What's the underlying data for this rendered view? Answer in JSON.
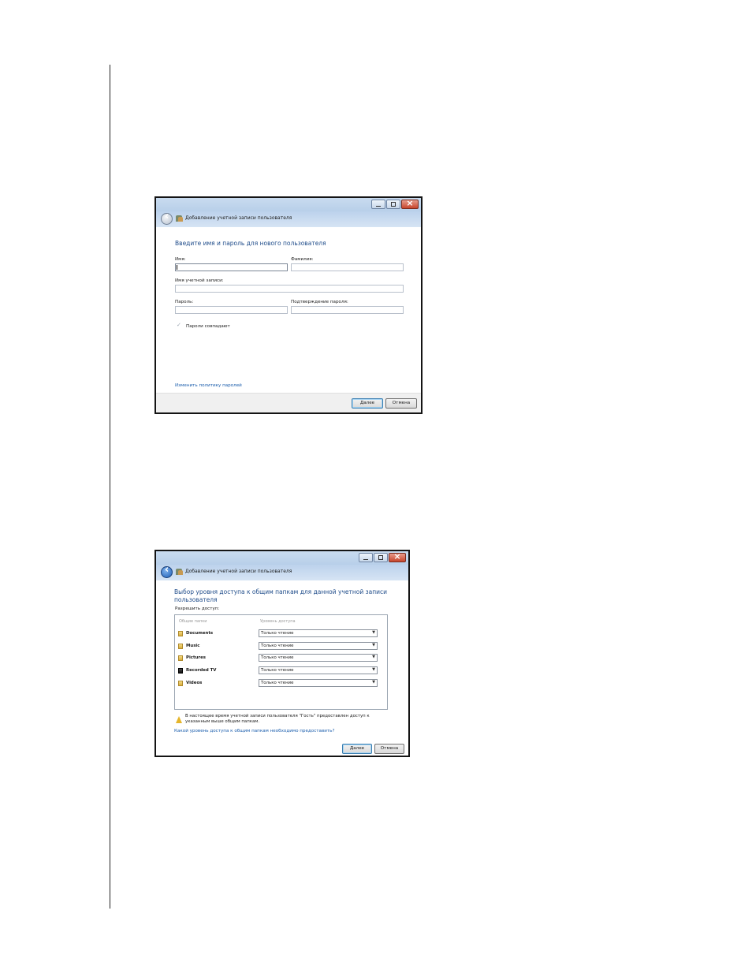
{
  "dialog_add_user": {
    "title": "Добавление учетной записи пользователя",
    "heading": "Введите имя и пароль для нового пользователя",
    "first_name_label": "Имя:",
    "last_name_label": "Фамилия:",
    "account_name_label": "Имя учетной записи:",
    "password_label": "Пароль:",
    "confirm_password_label": "Подтверждение пароля:",
    "passwords_match_text": "Пароли совпадают",
    "change_policy_link": "Изменить политику паролей",
    "next_button": "Далее",
    "cancel_button": "Отмена",
    "first_name_value": "",
    "last_name_value": "",
    "account_name_value": "",
    "password_value": "",
    "confirm_password_value": ""
  },
  "dialog_share_access": {
    "title": "Добавление учетной записи пользователя",
    "heading": "Выбор уровня доступа к общим папкам для данной учетной записи пользователя",
    "allow_access_label": "Разрешить доступ:",
    "columns": [
      "Общие папки",
      "Уровень доступа"
    ],
    "folders": [
      {
        "name": "Documents",
        "access": "Только чтение",
        "icon": "folder-icon"
      },
      {
        "name": "Music",
        "access": "Только чтение",
        "icon": "folder-icon"
      },
      {
        "name": "Pictures",
        "access": "Только чтение",
        "icon": "folder-icon"
      },
      {
        "name": "Recorded TV",
        "access": "Только чтение",
        "icon": "tv-folder-icon"
      },
      {
        "name": "Videos",
        "access": "Только чтение",
        "icon": "folder-icon"
      }
    ],
    "warning_text": "В настоящее время учетной записи пользователя \"Гость\" предоставлен доступ к указанным выше общим папкам.",
    "help_link": "Какой уровень доступа к общим папкам необходимо предоставить?",
    "next_button": "Далее",
    "cancel_button": "Отмена"
  }
}
